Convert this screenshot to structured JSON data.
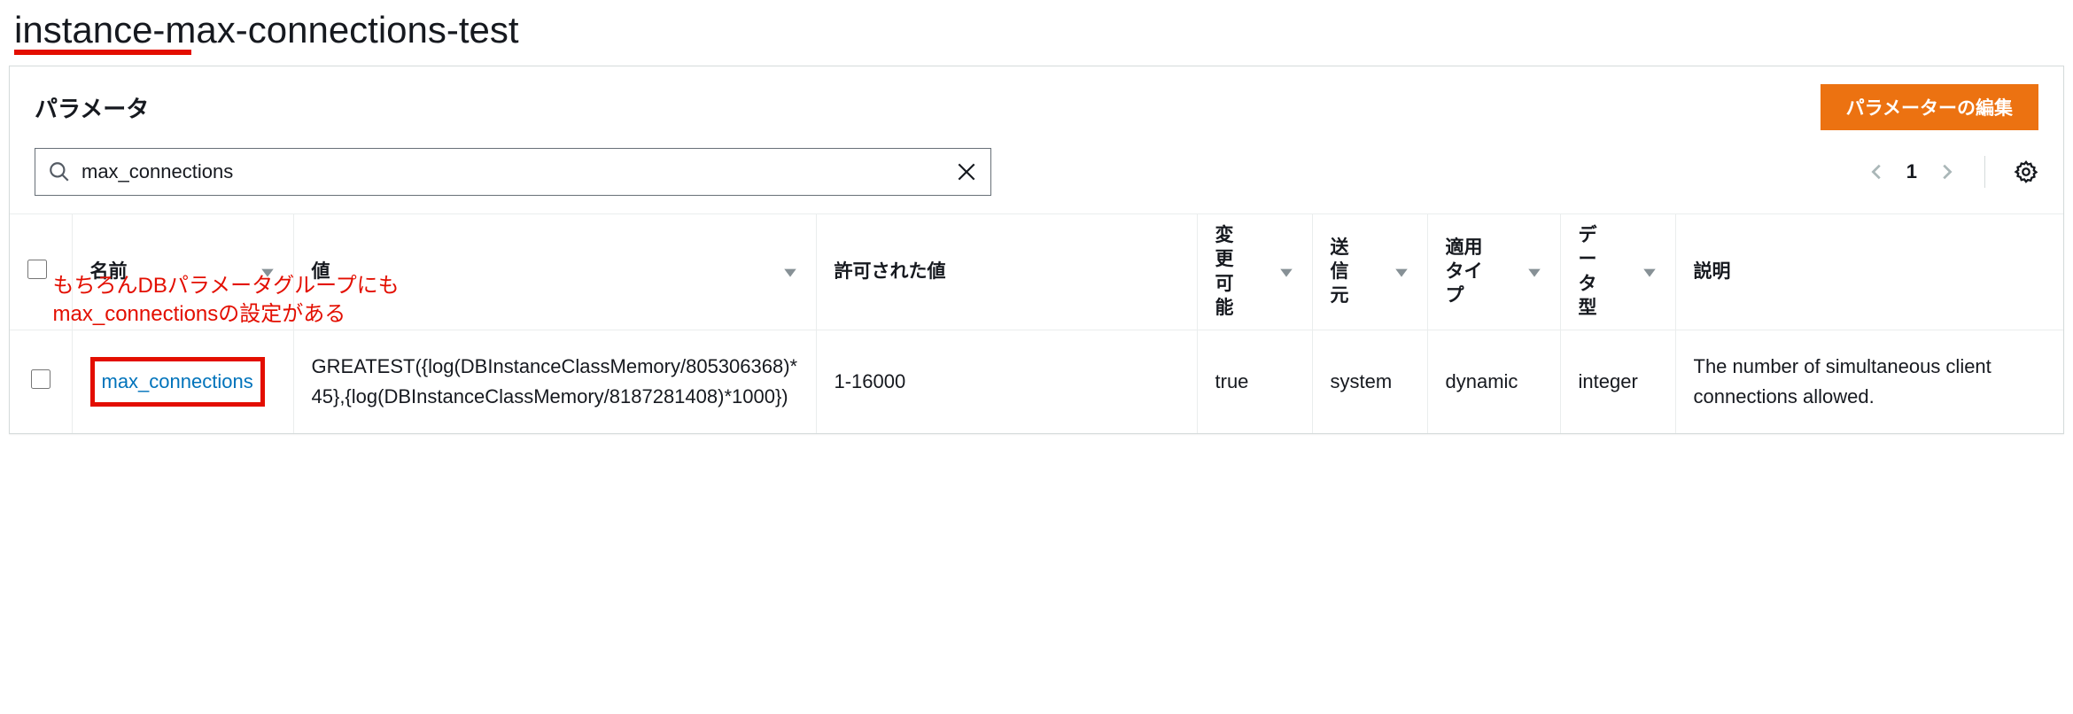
{
  "title": "instance-max-connections-test",
  "panel": {
    "title": "パラメータ",
    "edit_button_label": "パラメーターの編集"
  },
  "search": {
    "value": "max_connections",
    "placeholder": ""
  },
  "pagination": {
    "current": "1"
  },
  "columns": {
    "name": "名前",
    "value": "値",
    "allowed": "許可された値",
    "modifiable": "変更可能",
    "source": "送信元",
    "apply_type": "適用タイプ",
    "data_type": "データ型",
    "description": "説明"
  },
  "rows": [
    {
      "name": "max_connections",
      "value": "GREATEST({log(DBInstanceClassMemory/805306368)*45},{log(DBInstanceClassMemory/8187281408)*1000})",
      "allowed": "1-16000",
      "modifiable": "true",
      "source": "system",
      "apply_type": "dynamic",
      "data_type": "integer",
      "description": "The number of simultaneous client connections allowed."
    }
  ],
  "annotation": {
    "line1": "もちろんDBパラメータグループにも",
    "line2": "max_connectionsの設定がある"
  }
}
